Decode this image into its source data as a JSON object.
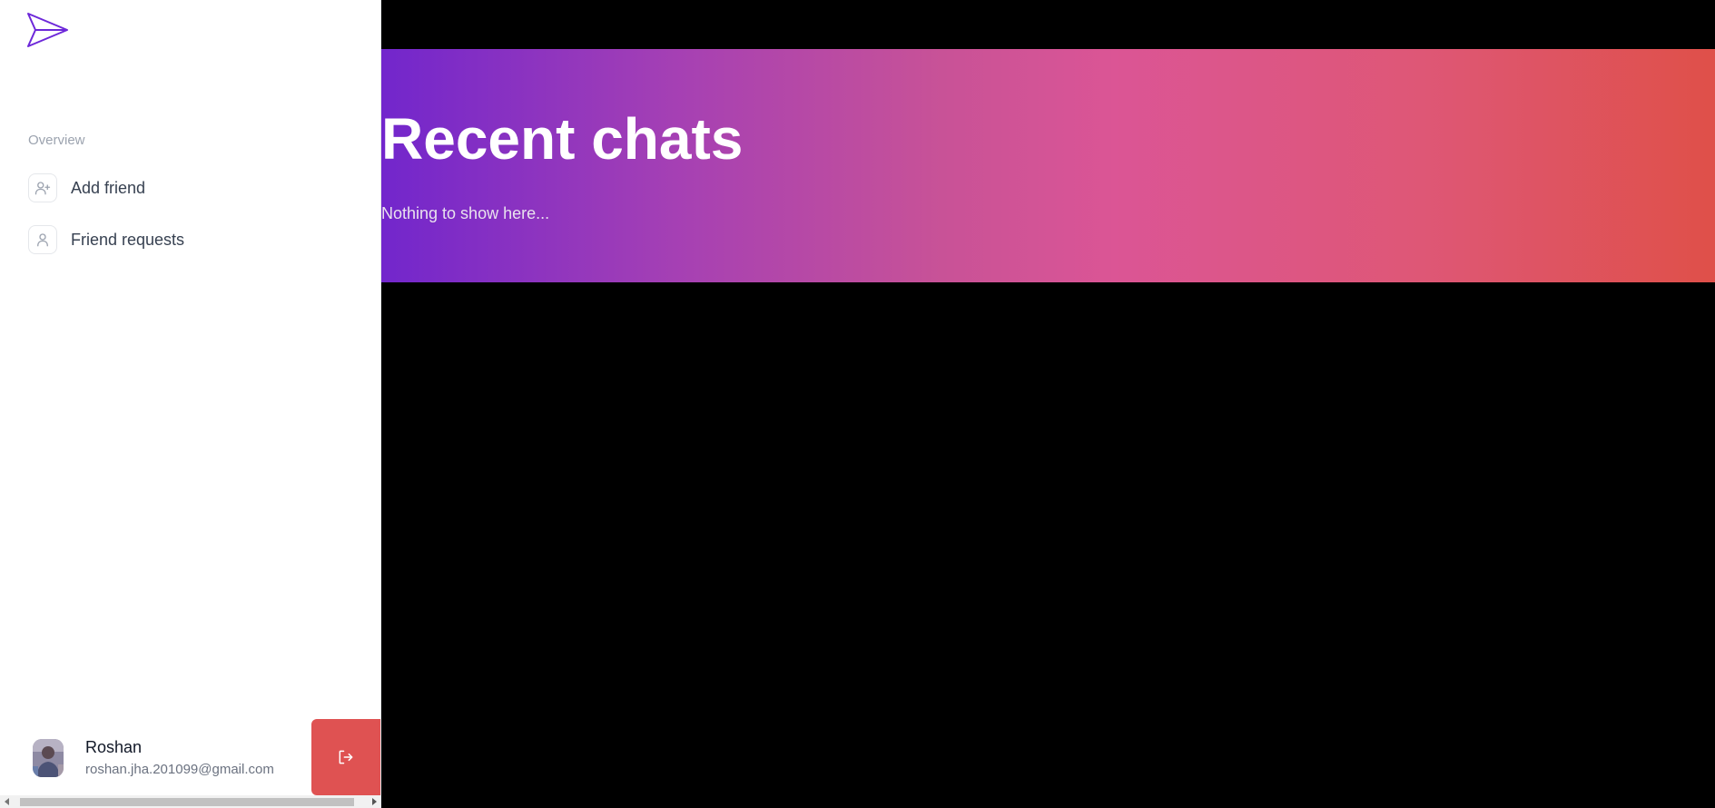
{
  "sidebar": {
    "logo_icon": "paper-plane-icon",
    "section_heading": "Overview",
    "items": [
      {
        "label": "Add friend",
        "icon": "user-plus-icon"
      },
      {
        "label": "Friend requests",
        "icon": "user-icon"
      }
    ],
    "profile": {
      "name": "Roshan",
      "email": "roshan.jha.201099@gmail.com"
    },
    "signout_icon": "sign-out-icon"
  },
  "main": {
    "title": "Recent chats",
    "empty_text": "Nothing to show here..."
  },
  "colors": {
    "accent": "#7226cc",
    "danger": "#df5252",
    "gradient": [
      "#7226cc",
      "#db5595",
      "#df5049"
    ]
  }
}
